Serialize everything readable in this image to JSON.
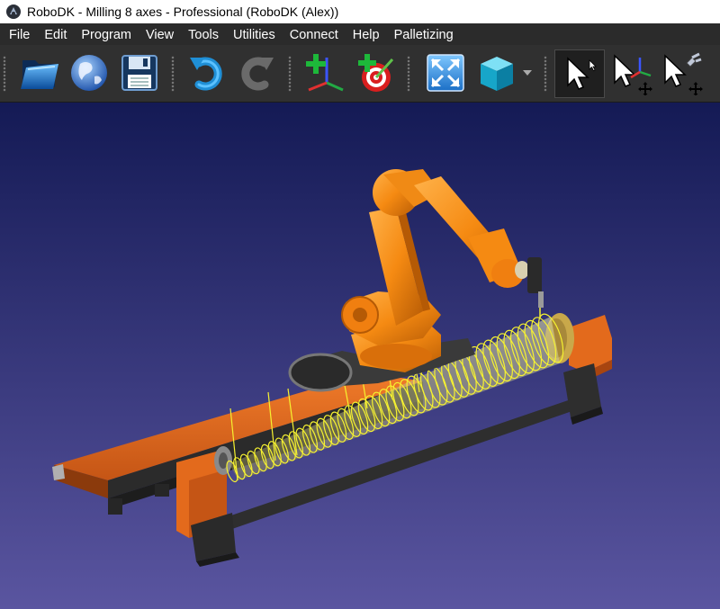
{
  "window": {
    "title": "RoboDK - Milling 8 axes - Professional (RoboDK (Alex))"
  },
  "menu": {
    "items": [
      "File",
      "Edit",
      "Program",
      "View",
      "Tools",
      "Utilities",
      "Connect",
      "Help",
      "Palletizing"
    ]
  },
  "toolbar": {
    "buttons": [
      {
        "icon": "open-folder-icon"
      },
      {
        "icon": "globe-icon"
      },
      {
        "icon": "save-icon"
      },
      {
        "icon": "undo-icon"
      },
      {
        "icon": "redo-icon"
      },
      {
        "icon": "add-reference-frame-icon"
      },
      {
        "icon": "add-target-icon"
      },
      {
        "icon": "fit-all-icon"
      },
      {
        "icon": "view-cube-icon"
      },
      {
        "icon": "dropdown-arrow-icon"
      },
      {
        "icon": "select-pointer-icon"
      },
      {
        "icon": "move-reference-pointer-icon"
      },
      {
        "icon": "move-tool-pointer-icon"
      }
    ]
  },
  "viewport": {
    "scene": "robot-milling-cell",
    "colors": {
      "background_top": "#141a55",
      "background_bottom": "#5a55a0",
      "robot": "#f58a12",
      "rail": "#e36a1c",
      "toolpath": "#f6f230",
      "base": "#3a3a3a"
    }
  }
}
